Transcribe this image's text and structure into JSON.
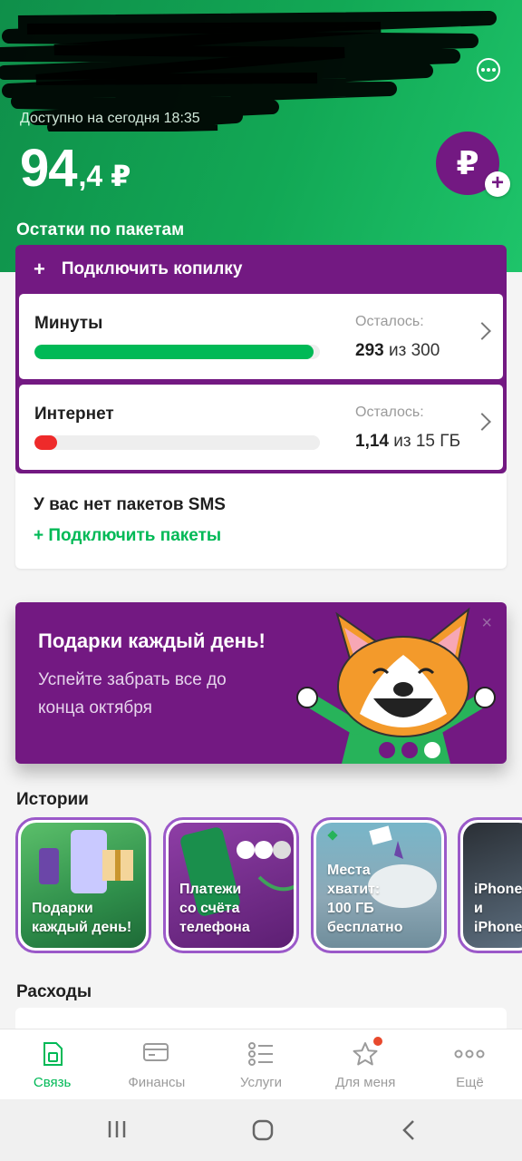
{
  "header": {
    "available_text": "Доступно на сегодня 18:35",
    "balance_whole": "94",
    "balance_frac": ",4 ₽",
    "topup_symbol": "₽",
    "topup_plus": "+"
  },
  "packages": {
    "title": "Остатки по пакетам",
    "piggy_plus": "+",
    "piggy_label": "Подключить копилку",
    "items": [
      {
        "name": "Минуты",
        "left_label": "Осталось:",
        "value": "293",
        "total": " из 300",
        "fraction": 0.977,
        "color": "#00b956"
      },
      {
        "name": "Интернет",
        "left_label": "Осталось:",
        "value": "1,14",
        "total": " из 15 ГБ",
        "fraction": 0.076,
        "color": "#ee2a2a"
      }
    ],
    "sms_text": "У вас нет пакетов SMS",
    "sms_action": "+  Подключить пакеты"
  },
  "promo": {
    "title": "Подарки каждый день!",
    "subtitle": "Успейте забрать все до конца октября",
    "close": "×"
  },
  "stories": {
    "title": "Истории",
    "items": [
      {
        "caption": "Подарки\nкаждый день!"
      },
      {
        "caption": "Платежи\nсо счёта\nтелефона"
      },
      {
        "caption": "Места\nхватит:\n100 ГБ\nбесплатно"
      },
      {
        "caption": "iPhone\nи iPhone"
      }
    ]
  },
  "expenses": {
    "title": "Расходы"
  },
  "tabs": [
    {
      "label": "Связь",
      "icon": "sim-icon",
      "active": true
    },
    {
      "label": "Финансы",
      "icon": "card-icon",
      "active": false
    },
    {
      "label": "Услуги",
      "icon": "list-icon",
      "active": false
    },
    {
      "label": "Для меня",
      "icon": "star-icon",
      "active": false
    },
    {
      "label": "Ещё",
      "icon": "more-icon",
      "active": false
    }
  ],
  "colors": {
    "brand_green": "#00b956",
    "brand_purple": "#731982",
    "alert_red": "#ee2a2a"
  }
}
